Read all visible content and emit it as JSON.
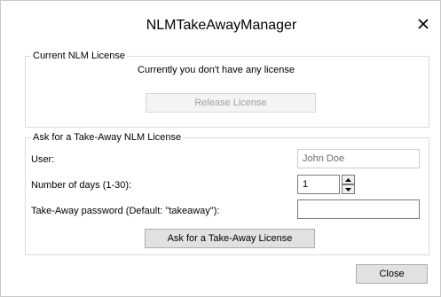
{
  "window": {
    "title": "NLMTakeAwayManager"
  },
  "current_license": {
    "legend": "Current NLM License",
    "status_text": "Currently you don't have any license",
    "release_button": "Release License"
  },
  "take_away": {
    "legend": "Ask for a Take-Away NLM License",
    "user_label": "User:",
    "user_value": "John Doe",
    "days_label": "Number of days (1-30):",
    "days_value": "1",
    "password_label": "Take-Away password (Default: \"takeaway\"):",
    "password_value": "",
    "ask_button": "Ask for a Take-Away License"
  },
  "footer": {
    "close_button": "Close"
  },
  "icons": {
    "close": "close-icon",
    "spin_up": "arrow-up-icon",
    "spin_down": "arrow-down-icon"
  }
}
